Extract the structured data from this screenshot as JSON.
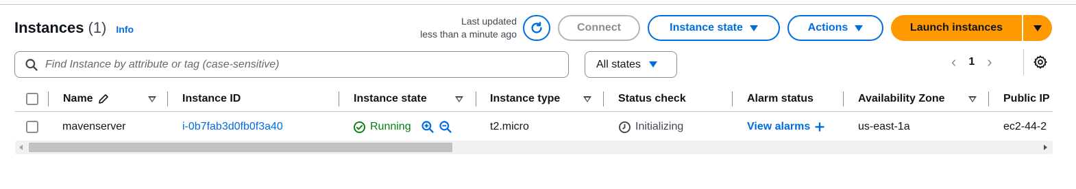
{
  "header": {
    "title": "Instances",
    "count": "(1)",
    "info_link": "Info",
    "last_updated_line1": "Last updated",
    "last_updated_line2": "less than a minute ago",
    "refresh_icon": "refresh-icon"
  },
  "toolbar": {
    "connect_label": "Connect",
    "instance_state_label": "Instance state",
    "actions_label": "Actions",
    "launch_label": "Launch instances"
  },
  "filter": {
    "search_placeholder": "Find Instance by attribute or tag (case-sensitive)",
    "search_value": "",
    "state_filter": "All states"
  },
  "pagination": {
    "current_page": "1",
    "prev": "‹",
    "next": "›"
  },
  "table": {
    "columns": [
      "Name",
      "Instance ID",
      "Instance state",
      "Instance type",
      "Status check",
      "Alarm status",
      "Availability Zone",
      "Public IP"
    ],
    "rows": [
      {
        "name": "mavenserver",
        "instance_id": "i-0b7fab3d0fb0f3a40",
        "state": "Running",
        "type": "t2.micro",
        "status_check": "Initializing",
        "alarm_status": "View alarms",
        "availability_zone": "us-east-1a",
        "public_ip": "ec2-44-2"
      }
    ]
  },
  "colors": {
    "primary_blue": "#006ce0",
    "launch_orange": "#ff9900",
    "running_green": "#037f0c",
    "disabled_gray": "#8c8c94"
  }
}
